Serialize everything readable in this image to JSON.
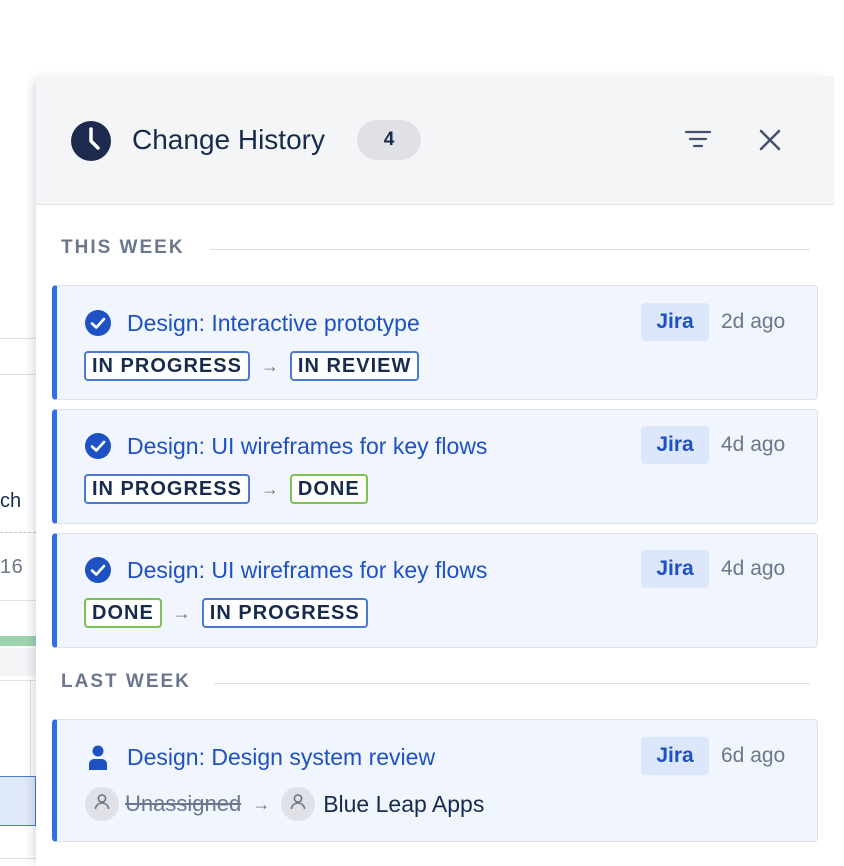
{
  "background": {
    "partial_label": "ch",
    "partial_date": "16"
  },
  "panel": {
    "title": "Change History",
    "count": "4",
    "icons": {
      "header": "clock-icon",
      "filter": "filter-icon",
      "close": "close-icon"
    }
  },
  "sections": [
    {
      "label": "THIS WEEK",
      "items": [
        {
          "icon": "check-circle-icon",
          "title": "Design: Interactive prototype",
          "source": "Jira",
          "time": "2d ago",
          "from": "IN PROGRESS",
          "to": "IN REVIEW",
          "from_color": "#4c7ad3",
          "to_color": "#4c7ad3"
        },
        {
          "icon": "check-circle-icon",
          "title": "Design: UI wireframes for key flows",
          "source": "Jira",
          "time": "4d ago",
          "from": "IN PROGRESS",
          "to": "DONE",
          "from_color": "#4c7ad3",
          "to_color": "#7cc152"
        },
        {
          "icon": "check-circle-icon",
          "title": "Design: UI wireframes for key flows",
          "source": "Jira",
          "time": "4d ago",
          "from": "DONE",
          "to": "IN PROGRESS",
          "from_color": "#7cc152",
          "to_color": "#4c7ad3"
        }
      ]
    },
    {
      "label": "LAST WEEK",
      "items": [
        {
          "icon": "person-icon",
          "title": "Design: Design system review",
          "source": "Jira",
          "time": "6d ago",
          "from": "Unassigned",
          "to": "Blue Leap Apps"
        }
      ]
    }
  ],
  "colors": {
    "accent": "#2f6fe4",
    "link": "#1e52c4",
    "card_bg": "#f1f5fd",
    "header_bg": "#f4f5f7"
  }
}
